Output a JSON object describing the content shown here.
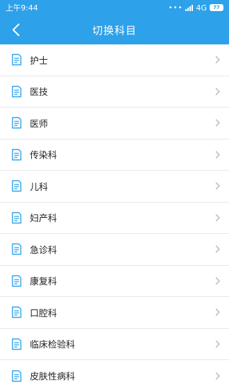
{
  "status": {
    "time": "上午9:44",
    "network": "4G",
    "battery": "77"
  },
  "header": {
    "title": "切换科目"
  },
  "subjects": [
    {
      "label": "护士"
    },
    {
      "label": "医技"
    },
    {
      "label": "医师"
    },
    {
      "label": "传染科"
    },
    {
      "label": "儿科"
    },
    {
      "label": "妇产科"
    },
    {
      "label": "急诊科"
    },
    {
      "label": "康复科"
    },
    {
      "label": "口腔科"
    },
    {
      "label": "临床检验科"
    },
    {
      "label": "皮肤性病科"
    }
  ],
  "colors": {
    "accent": "#2da1ea",
    "divider": "#e6e6e6",
    "chevron": "#b5b5b5"
  }
}
